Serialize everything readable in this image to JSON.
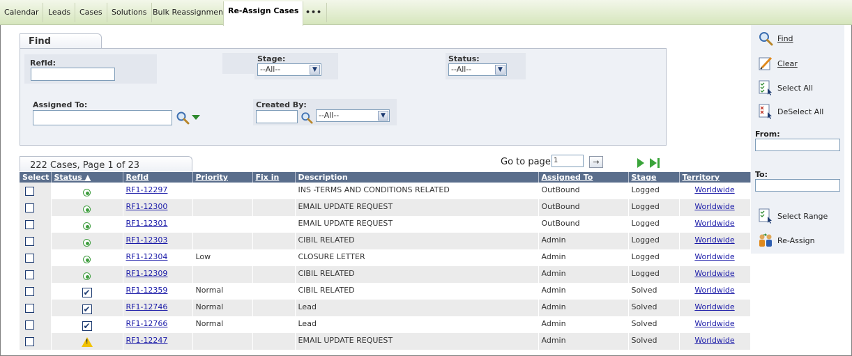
{
  "tabs": [
    "Calendar",
    "Leads",
    "Cases",
    "Solutions",
    "Bulk Reassignment",
    "Re-Assign Cases",
    "•••"
  ],
  "find": {
    "tab_label": "Find",
    "refid_label": "RefId:",
    "refid_value": "",
    "stage_label": "Stage:",
    "stage_value": "--All--",
    "status_label": "Status:",
    "status_value": "--All--",
    "assigned_to_label": "Assigned To:",
    "assigned_to_value": "",
    "created_by_label": "Created By:",
    "created_by_value": "",
    "created_by_select": "--All--"
  },
  "results": {
    "summary": "222 Cases, Page 1 of 23",
    "goto_label": "Go to page",
    "goto_value": "1",
    "goto_button": "→"
  },
  "table": {
    "headers": [
      "Select",
      "Status ▲",
      "RefId",
      "Priority",
      "Fix in",
      "Description",
      "Assigned To",
      "Stage",
      "Territory"
    ],
    "rows": [
      {
        "status": "in-progress",
        "refid": "RF1-12297",
        "priority": "",
        "fixin": "",
        "description": "INS -TERMS AND CONDITIONS RELATED",
        "assigned": "OutBound",
        "stage": "Logged",
        "territory": "Worldwide"
      },
      {
        "status": "in-progress",
        "refid": "RF1-12300",
        "priority": "",
        "fixin": "",
        "description": "EMAIL UPDATE REQUEST",
        "assigned": "OutBound",
        "stage": "Logged",
        "territory": "Worldwide"
      },
      {
        "status": "in-progress",
        "refid": "RF1-12301",
        "priority": "",
        "fixin": "",
        "description": "EMAIL UPDATE REQUEST",
        "assigned": "OutBound",
        "stage": "Logged",
        "territory": "Worldwide"
      },
      {
        "status": "in-progress",
        "refid": "RF1-12303",
        "priority": "",
        "fixin": "",
        "description": "CIBIL RELATED",
        "assigned": "Admin",
        "stage": "Logged",
        "territory": "Worldwide"
      },
      {
        "status": "in-progress",
        "refid": "RF1-12304",
        "priority": "Low",
        "fixin": "",
        "description": "CLOSURE LETTER",
        "assigned": "Admin",
        "stage": "Logged",
        "territory": "Worldwide"
      },
      {
        "status": "in-progress",
        "refid": "RF1-12309",
        "priority": "",
        "fixin": "",
        "description": "CIBIL RELATED",
        "assigned": "Admin",
        "stage": "Logged",
        "territory": "Worldwide"
      },
      {
        "status": "done",
        "refid": "RF1-12359",
        "priority": "Normal",
        "fixin": "",
        "description": "CIBIL RELATED",
        "assigned": "Admin",
        "stage": "Solved",
        "territory": "Worldwide"
      },
      {
        "status": "done",
        "refid": "RF1-12746",
        "priority": "Normal",
        "fixin": "",
        "description": "Lead",
        "assigned": "Admin",
        "stage": "Solved",
        "territory": "Worldwide"
      },
      {
        "status": "done",
        "refid": "RF1-12766",
        "priority": "Normal",
        "fixin": "",
        "description": "Lead",
        "assigned": "Admin",
        "stage": "Solved",
        "territory": "Worldwide"
      },
      {
        "status": "warning",
        "refid": "RF1-12247",
        "priority": "",
        "fixin": "",
        "description": "EMAIL UPDATE REQUEST",
        "assigned": "Admin",
        "stage": "Solved",
        "territory": "Worldwide"
      }
    ]
  },
  "actions": {
    "find": "Find",
    "clear": "Clear",
    "select_all": "Select All",
    "deselect_all": "DeSelect All",
    "from_label": "From:",
    "to_label": "To:",
    "select_range": "Select Range",
    "reassign": "Re-Assign"
  },
  "icons": {
    "in-progress": "green-radio-icon",
    "done": "checked-box-icon",
    "warning": "warning-icon"
  },
  "colors": {
    "header_bg": "#5a6e8c",
    "panel_bg": "#eef1f6",
    "tabbar_bg": "#d6e6bd",
    "link": "#1a1aa8"
  }
}
